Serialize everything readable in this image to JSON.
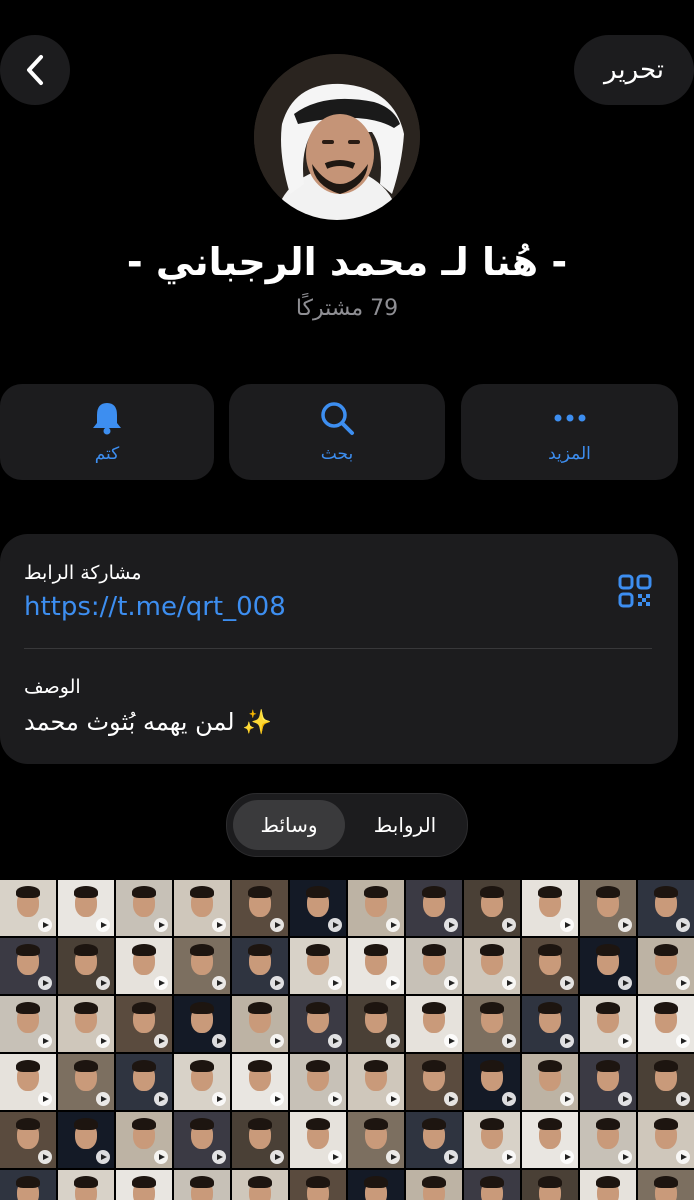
{
  "header": {
    "edit_label": "تحرير",
    "back_icon": "chevron-left-icon"
  },
  "profile": {
    "title": "- هُنا لـ محمد الرجباني -",
    "subscribers": "79 مشتركًا"
  },
  "actions": [
    {
      "label": "كتم",
      "icon": "bell-icon"
    },
    {
      "label": "بحث",
      "icon": "search-icon"
    },
    {
      "label": "المزيد",
      "icon": "more-icon"
    }
  ],
  "info": {
    "share_label": "مشاركة الرابط",
    "link": "https://t.me/qrt_008",
    "description_label": "الوصف",
    "description": "لمن يهمه بُثوث محمد ✨"
  },
  "tabs": [
    {
      "label": "الروابط",
      "active": false
    },
    {
      "label": "وسائط",
      "active": true
    }
  ],
  "colors": {
    "accent": "#3d8ef0",
    "background": "#000000",
    "card": "#1c1c1e",
    "muted": "#8e8e93"
  }
}
